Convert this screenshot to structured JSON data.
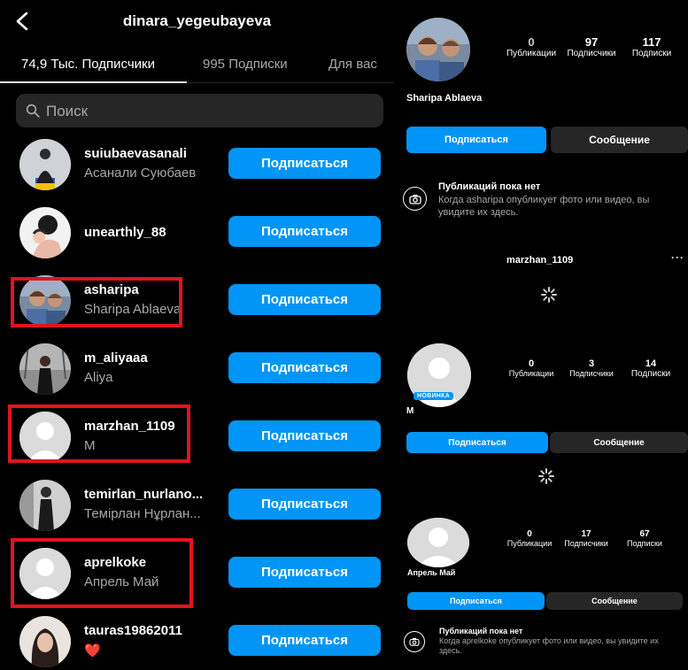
{
  "header": {
    "title": "dinara_yegeubayeva",
    "back_icon": "chevron-left-icon"
  },
  "tabs": [
    {
      "label": "74,9 Тыс. Подписчики",
      "active": true
    },
    {
      "label": "995 Подписки",
      "active": false
    },
    {
      "label": "Для вас",
      "active": false
    }
  ],
  "search": {
    "placeholder": "Поиск",
    "icon": "search-icon"
  },
  "followers": [
    {
      "username": "suiubaevasanali",
      "full_name": "Асанали Суюбаев",
      "button": "Подписаться",
      "highlighted": false
    },
    {
      "username": "unearthly_88",
      "full_name": "",
      "button": "Подписаться",
      "highlighted": false
    },
    {
      "username": "asharipa",
      "full_name": "Sharipa Ablaeva",
      "button": "Подписаться",
      "highlighted": true
    },
    {
      "username": "m_aliyaaa",
      "full_name": "Aliya",
      "button": "Подписаться",
      "highlighted": false
    },
    {
      "username": "marzhan_1109",
      "full_name": "M",
      "button": "Подписаться",
      "highlighted": true
    },
    {
      "username": "temirlan_nurlano...",
      "full_name": "Темірлан Нұрлан...",
      "button": "Подписаться",
      "highlighted": false
    },
    {
      "username": "aprelkoke",
      "full_name": "Апрель Май",
      "button": "Подписаться",
      "highlighted": true
    },
    {
      "username": "tauras19862011",
      "full_name": "❤️",
      "button": "Подписаться",
      "highlighted": false
    }
  ],
  "profiles": [
    {
      "name": "Sharipa Ablaeva",
      "stats": [
        {
          "num": "0",
          "label": "Публикации"
        },
        {
          "num": "97",
          "label": "Подписчики"
        },
        {
          "num": "117",
          "label": "Подписки"
        }
      ],
      "follow": "Подписаться",
      "message": "Сообщение",
      "empty_title": "Публикаций пока нет",
      "empty_sub": "Когда asharipa опубликует фото или видео, вы увидите их здесь."
    },
    {
      "header_username": "marzhan_1109",
      "more_icon": "more-dots-icon",
      "name": "M",
      "badge": "НОВИНКА",
      "stats": [
        {
          "num": "0",
          "label": "Публикации"
        },
        {
          "num": "3",
          "label": "Подписчики"
        },
        {
          "num": "14",
          "label": "Подписки"
        }
      ],
      "follow": "Подписаться",
      "message": "Сообщение"
    },
    {
      "name": "Апрель Май",
      "stats": [
        {
          "num": "0",
          "label": "Публикации"
        },
        {
          "num": "17",
          "label": "Подписчики"
        },
        {
          "num": "67",
          "label": "Подписки"
        }
      ],
      "follow": "Подписаться",
      "message": "Сообщение",
      "empty_title": "Публикаций пока нет",
      "empty_sub": "Когда aprelkoke опубликует фото или видео, вы увидите их здесь."
    }
  ],
  "colors": {
    "accent": "#0095f6",
    "highlight": "#e0141c",
    "muted": "#a8a8a8",
    "surface": "#262626"
  }
}
